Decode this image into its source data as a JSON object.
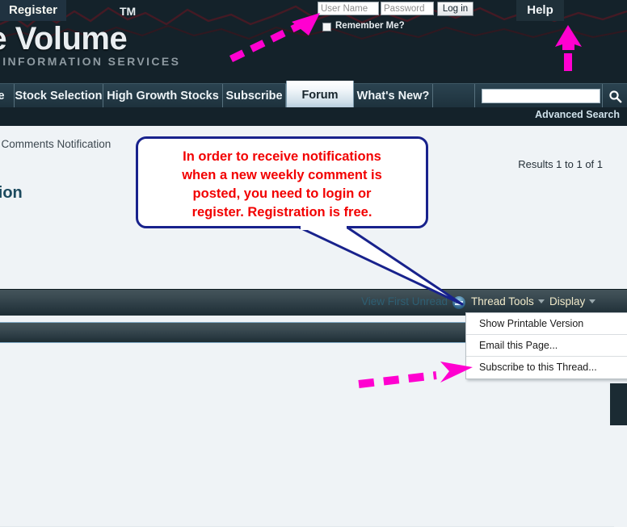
{
  "header": {
    "logo_main": "ive Volume",
    "logo_tm": "TM",
    "logo_sub": "T INFORMATION SERVICES",
    "login": {
      "username_placeholder": "User Name",
      "username_value": "",
      "password_placeholder": "Password",
      "password_value": "",
      "login_button": "Log in",
      "remember_label": "Remember Me?"
    },
    "help_button": "Help",
    "register_button": "Register"
  },
  "nav": {
    "tabs": [
      {
        "label": "e",
        "active": false
      },
      {
        "label": "Stock Selection",
        "active": false
      },
      {
        "label": "High Growth Stocks",
        "active": false
      },
      {
        "label": "Subscribe",
        "active": false
      },
      {
        "label": "Forum",
        "active": true
      },
      {
        "label": "What's New?",
        "active": false
      }
    ],
    "search_value": "",
    "search_icon": "search-icon",
    "advanced_search": "Advanced Search"
  },
  "content": {
    "breadcrumb": "y Comments Notification",
    "page_title": "ation",
    "results": "Results 1 to 1 of 1"
  },
  "toolbar": {
    "view_first_unread": "View First Unread",
    "view_first_unread_icon": "unread-post-icon",
    "thread_tools": "Thread Tools",
    "display": "Display"
  },
  "dropdown": {
    "items": [
      "Show Printable Version",
      "Email this Page...",
      "Subscribe to this Thread..."
    ]
  },
  "annotations": {
    "callout_text": "In order to receive notifications when a new weekly comment is posted, you need to login or register. Registration is free.",
    "callout_lines": [
      "In order to receive notifications",
      "when a new weekly comment is",
      "posted, you need to login or",
      "register. Registration is free."
    ],
    "arrow_color": "#ff00d0",
    "callout_border_color": "#18228c",
    "callout_text_color": "#f20000"
  }
}
